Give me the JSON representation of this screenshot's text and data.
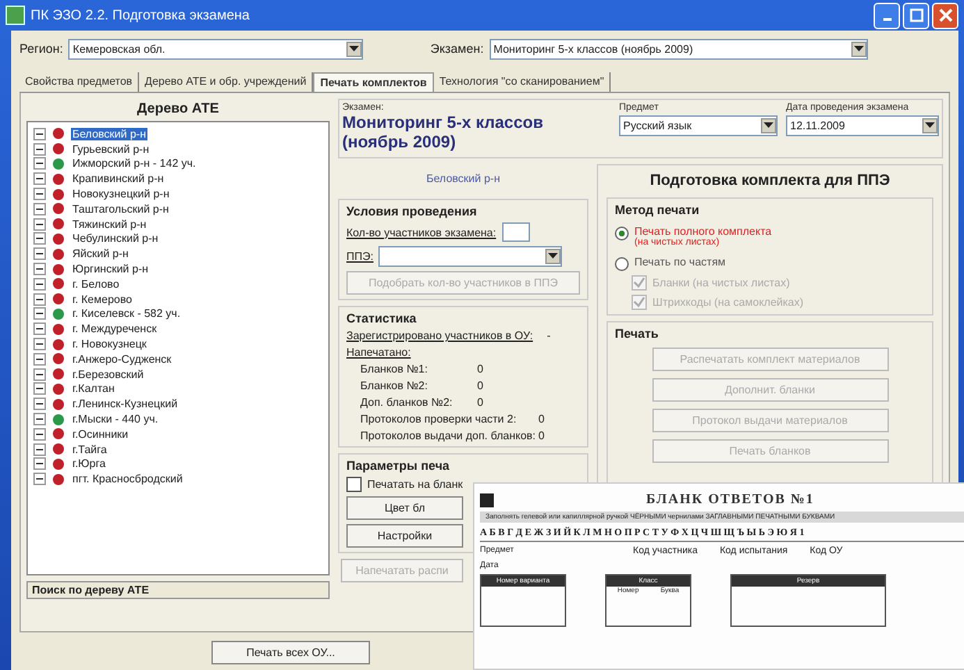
{
  "window": {
    "title": "ПК ЭЗО 2.2. Подготовка экзамена"
  },
  "region": {
    "label": "Регион:",
    "value": "Кемеровская обл."
  },
  "exam_select": {
    "label": "Экзамен:",
    "value": "Мониторинг 5-х классов (ноябрь 2009)"
  },
  "tabs": [
    {
      "label": "Свойства предметов",
      "selected": false
    },
    {
      "label": "Дерево АТЕ и обр. учреждений",
      "selected": false
    },
    {
      "label": "Печать комплектов",
      "selected": true
    },
    {
      "label": "Технология \"со сканированием\"",
      "selected": false
    }
  ],
  "tree_panel": {
    "title": "Дерево АТЕ",
    "search_label": "Поиск по дереву АТЕ",
    "items": [
      {
        "label": "Беловский р-н",
        "color": "#c0202a",
        "selected": true
      },
      {
        "label": "Гурьевский р-н",
        "color": "#c0202a",
        "selected": false
      },
      {
        "label": "Ижморский р-н - 142 уч.",
        "color": "#2a9a4a",
        "selected": false
      },
      {
        "label": "Крапивинский р-н",
        "color": "#c0202a",
        "selected": false
      },
      {
        "label": "Новокузнецкий р-н",
        "color": "#c0202a",
        "selected": false
      },
      {
        "label": "Таштагольский р-н",
        "color": "#c0202a",
        "selected": false
      },
      {
        "label": "Тяжинский р-н",
        "color": "#c0202a",
        "selected": false
      },
      {
        "label": "Чебулинский р-н",
        "color": "#c0202a",
        "selected": false
      },
      {
        "label": "Яйский р-н",
        "color": "#c0202a",
        "selected": false
      },
      {
        "label": "Юргинский р-н",
        "color": "#c0202a",
        "selected": false
      },
      {
        "label": "г. Белово",
        "color": "#c0202a",
        "selected": false
      },
      {
        "label": "г. Кемерово",
        "color": "#c0202a",
        "selected": false
      },
      {
        "label": "г. Киселевск - 582 уч.",
        "color": "#2a9a4a",
        "selected": false
      },
      {
        "label": "г. Междуреченск",
        "color": "#c0202a",
        "selected": false
      },
      {
        "label": "г. Новокузнецк",
        "color": "#c0202a",
        "selected": false
      },
      {
        "label": "г.Анжеро-Судженск",
        "color": "#c0202a",
        "selected": false
      },
      {
        "label": "г.Березовский",
        "color": "#c0202a",
        "selected": false
      },
      {
        "label": "г.Калтан",
        "color": "#c0202a",
        "selected": false
      },
      {
        "label": "г.Ленинск-Кузнецкий",
        "color": "#c0202a",
        "selected": false
      },
      {
        "label": "г.Мыски - 440 уч.",
        "color": "#2a9a4a",
        "selected": false
      },
      {
        "label": "г.Осинники",
        "color": "#c0202a",
        "selected": false
      },
      {
        "label": "г.Тайга",
        "color": "#c0202a",
        "selected": false
      },
      {
        "label": "г.Юрга",
        "color": "#c0202a",
        "selected": false
      },
      {
        "label": "пгт. Красносбродский",
        "color": "#c0202a",
        "selected": false
      }
    ]
  },
  "print_all_button": "Печать всех ОУ...",
  "exam": {
    "label": "Экзамен:",
    "title": "Мониторинг 5-х классов (ноябрь 2009)"
  },
  "subject": {
    "label": "Предмет",
    "value": "Русский язык"
  },
  "date": {
    "label": "Дата проведения экзамена",
    "value": "12.11.2009"
  },
  "selected_unit": "Беловский р-н",
  "conditions": {
    "title": "Условия проведения",
    "count_label": "Кол-во участников экзамена:",
    "ppe_label": "ППЭ:",
    "button": {
      "label": "Подобрать кол-во участников в ППЭ",
      "disabled": true
    }
  },
  "statistics": {
    "title": "Статистика",
    "registered_label": "Зарегистрировано участников в ОУ:",
    "registered_value": "-",
    "printed_label": "Напечатано:",
    "rows": [
      {
        "label": "Бланков №1:",
        "value": "0",
        "kind": "indent"
      },
      {
        "label": "Бланков №2:",
        "value": "0",
        "kind": "indent"
      },
      {
        "label": "Доп. бланков №2:",
        "value": "0",
        "kind": "indent"
      },
      {
        "label": "Протоколов проверки части 2:",
        "value": "0",
        "kind": "wide"
      },
      {
        "label": "Протоколов выдачи доп. бланков:",
        "value": "0",
        "kind": "wide"
      }
    ]
  },
  "print_params": {
    "title": "Параметры печа",
    "checkbox": {
      "label": "Печатать на бланк",
      "checked": false
    },
    "buttons": [
      {
        "label": "Цвет бл",
        "disabled": false
      },
      {
        "label": "Настройки",
        "disabled": false
      },
      {
        "label": "Напечатать распи",
        "disabled": true
      }
    ]
  },
  "kit": {
    "title": "Подготовка комплекта для ППЭ",
    "method_title": "Метод печати",
    "options": [
      {
        "label": "Печать полного комплекта",
        "note": "(на чистых листах)",
        "selected": true
      },
      {
        "label": "Печать по частям",
        "selected": false,
        "children": [
          {
            "label": "Бланки (на чистых листах)",
            "checked": true,
            "disabled": true
          },
          {
            "label": "Штрихкоды (на самоклейках)",
            "checked": true,
            "disabled": true
          }
        ]
      }
    ],
    "print_title": "Печать",
    "buttons": [
      {
        "label": "Распечатать комплект материалов",
        "disabled": true
      },
      {
        "label": "Дополнит. бланки",
        "disabled": true
      },
      {
        "label": "Протокол выдачи материалов",
        "disabled": true
      },
      {
        "label": "Печать бланков",
        "disabled": true
      }
    ]
  },
  "document": {
    "title": "БЛАНК ОТВЕТОВ №1",
    "instruction": "Заполнять гелевой или капиллярной ручкой ЧЁРНЫМИ чернилами ЗАГЛАВНЫМИ ПЕЧАТНЫМИ БУКВАМИ",
    "alphabet": "А Б В Г Д Е Ж З И Й К Л М Н О П Р С Т У Ф Х Ц Ч Ш Щ Ъ Ы Ь Э Ю Я 1",
    "fields": [
      "Предмет",
      "Дата"
    ],
    "codes": [
      "Код участника",
      "Код испытания",
      "Код ОУ"
    ],
    "boxes": [
      {
        "title": "Номер варианта"
      },
      {
        "title": "Класс",
        "subs": [
          "Номер",
          "Буква"
        ]
      },
      {
        "title": "Резерв"
      }
    ]
  }
}
